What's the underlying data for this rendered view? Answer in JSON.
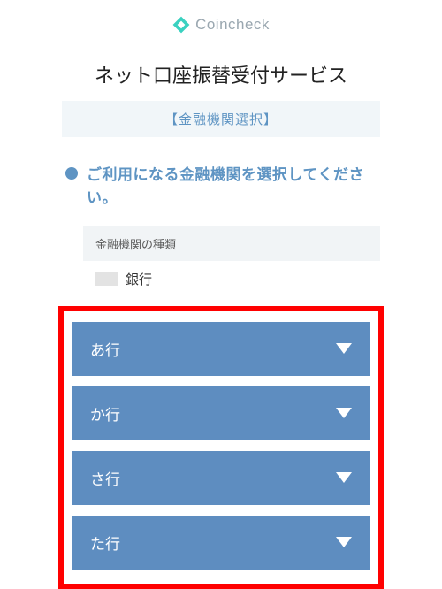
{
  "brand": {
    "name": "Coincheck"
  },
  "page": {
    "title": "ネット口座振替受付サービス",
    "section": "【金融機関選択】",
    "instruction": "ご利用になる金融機関を選択してください。",
    "type_label": "金融機関の種類",
    "type_value": "銀行"
  },
  "rows": [
    {
      "label": "あ行"
    },
    {
      "label": "か行"
    },
    {
      "label": "さ行"
    },
    {
      "label": "た行"
    }
  ]
}
